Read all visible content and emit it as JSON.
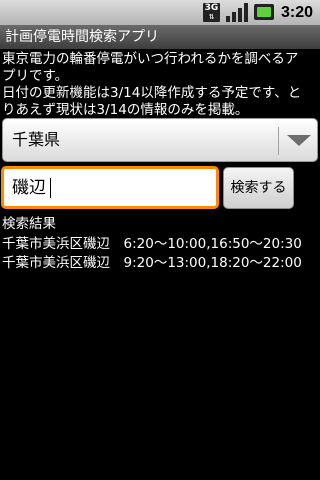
{
  "status_bar": {
    "network_label": "3G",
    "time": "3:20",
    "icons": [
      "3g-icon",
      "signal-icon",
      "battery-icon"
    ]
  },
  "app": {
    "title": "計画停電時間検索アプリ"
  },
  "description": [
    "東京電力の輪番停電がいつ行われるかを調べるア",
    "プリです。",
    "日付の更新機能は3/14以降作成する予定です、と",
    "りあえず現状は3/14の情報のみを掲載。"
  ],
  "prefecture_select": {
    "selected": "千葉県"
  },
  "search": {
    "value": "磯辺",
    "button_label": "検索する"
  },
  "results": {
    "header": "検索結果",
    "rows": [
      "千葉市美浜区磯辺　6:20～10:00,16:50～20:30",
      "千葉市美浜区磯辺　9:20～13:00,18:20～22:00"
    ]
  },
  "colors": {
    "focus_border": "#ff8a00",
    "background": "#000000",
    "battery": "#5fd13d"
  }
}
